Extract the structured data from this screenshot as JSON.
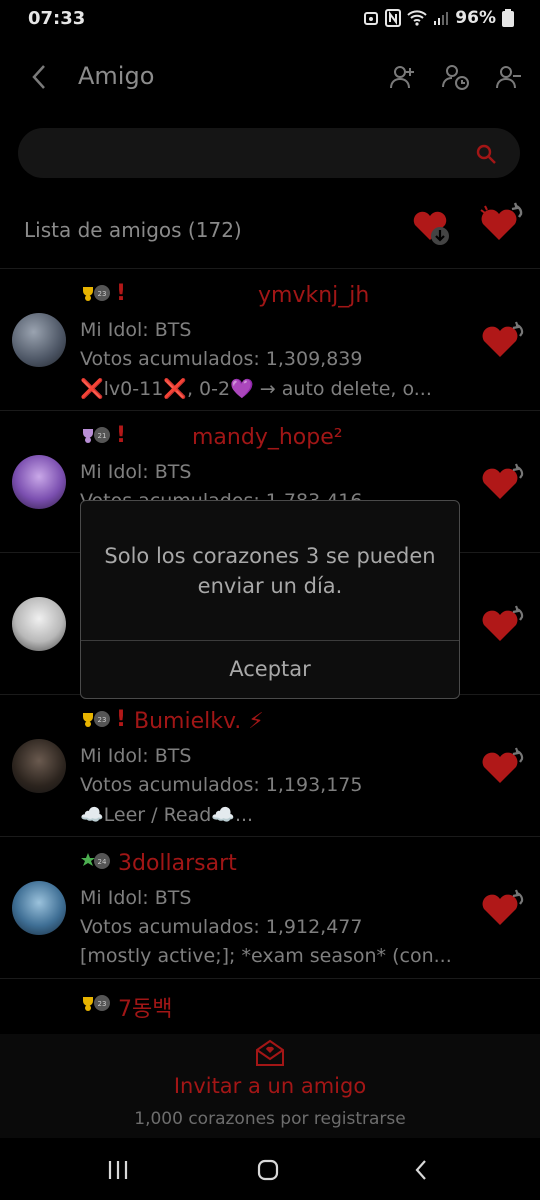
{
  "status_bar": {
    "time": "07:33",
    "battery": "96%"
  },
  "header": {
    "title": "Amigo"
  },
  "search": {
    "placeholder": ""
  },
  "friends": {
    "title": "Lista de amigos (172)",
    "rows": [
      {
        "level": "23",
        "badge_color": "#e8b400",
        "excl": "!",
        "name": "ymvknj_jh",
        "idol": "Mi Idol: BTS",
        "votes": "Votos acumulados: 1,309,839",
        "status": "❌lv0-11❌, 0-2💜 → auto delete, o..."
      },
      {
        "level": "21",
        "badge_color": "#b98fd6",
        "excl": "!",
        "name": "mandy_hope²",
        "idol": "Mi Idol: BTS",
        "votes": "Votos acumulados: 1,783,416",
        "status": ""
      },
      {
        "level": "",
        "badge_color": "",
        "excl": "",
        "name": "",
        "idol": "",
        "votes": "",
        "status": ""
      },
      {
        "level": "23",
        "badge_color": "#e8b400",
        "excl": "!",
        "name": "Bumielkv. ⚡",
        "idol": "Mi Idol: BTS",
        "votes": "Votos acumulados: 1,193,175",
        "status": "☁️Leer / Read☁️..."
      },
      {
        "level": "24",
        "badge_color": "#4caf50",
        "excl": "",
        "name": "3dollarsart",
        "idol": "Mi Idol: BTS",
        "votes": "Votos acumulados: 1,912,477",
        "status": "[mostly active;]; *exam season* (con..."
      },
      {
        "level": "23",
        "badge_color": "#e8b400",
        "excl": "",
        "name": "7동백",
        "idol": "",
        "votes": "",
        "status": ""
      }
    ]
  },
  "dialog": {
    "message_line1": "Solo los corazones 3 se pueden",
    "message_line2": "enviar un día.",
    "button": "Aceptar"
  },
  "footer": {
    "invite": "Invitar a un amigo",
    "invite_sub": "1,000 corazones por registrarse"
  },
  "colors": {
    "accent": "#a31616",
    "heart": "#b01818"
  }
}
